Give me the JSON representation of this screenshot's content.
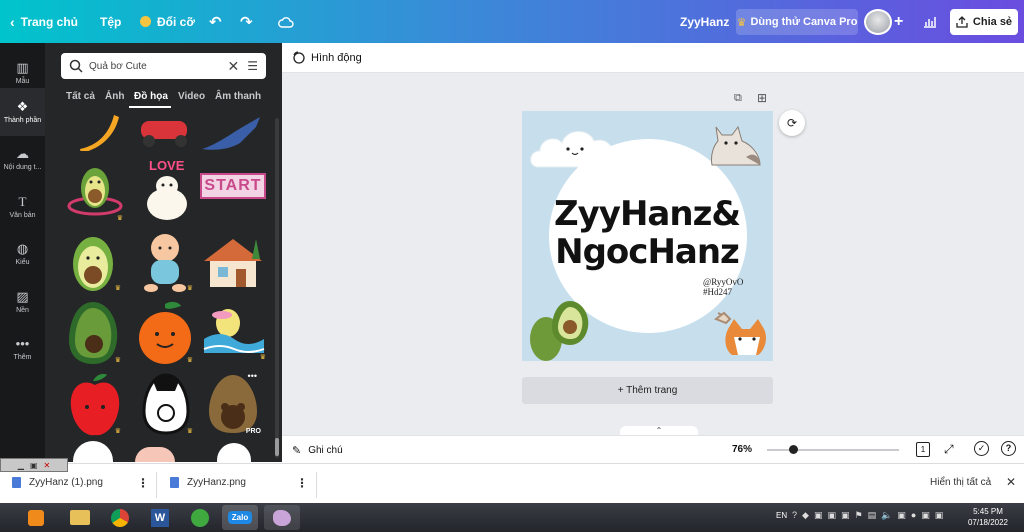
{
  "topbar": {
    "home_label": "Trang chủ",
    "file_label": "Tệp",
    "resize_label": "Đổi cỡ",
    "user_name": "ZyyHanz",
    "pro_label": "Dùng thử Canva Pro",
    "share_label": "Chia sẻ"
  },
  "rail": {
    "items": [
      {
        "label": "Mẫu",
        "icon": "template-icon"
      },
      {
        "label": "Thành phần",
        "icon": "elements-icon"
      },
      {
        "label": "Nội dung t...",
        "icon": "upload-icon"
      },
      {
        "label": "Văn bản",
        "icon": "text-icon"
      },
      {
        "label": "Kiểu",
        "icon": "style-icon"
      },
      {
        "label": "Nền",
        "icon": "background-icon"
      },
      {
        "label": "Thêm",
        "icon": "more-icon"
      }
    ]
  },
  "panel": {
    "search_value": "Quả bơ Cute",
    "tabs": [
      "Tất cả",
      "Ảnh",
      "Đồ họa",
      "Video",
      "Âm thanh"
    ],
    "active_tab": "Đồ họa",
    "love_text": "LOVE",
    "start_text": "START",
    "pro_badge": "PRO"
  },
  "subbar": {
    "animation_label": "Hình động"
  },
  "design": {
    "title_line1": "ZyyHanz&",
    "title_line2": "NgocHanz",
    "handle": "@RyyOvO",
    "tag": "#Hd247",
    "bg_color": "#c7dfed"
  },
  "add_page_label": "+ Thêm trang",
  "footer": {
    "notes_label": "Ghi chú",
    "zoom": "76%",
    "zoom_fraction": 0.2,
    "page_count": "1"
  },
  "downloads": {
    "items": [
      "ZyyHanz (1).png",
      "ZyyHanz.png"
    ],
    "show_all": "Hiển thị tất cả"
  },
  "taskbar": {
    "lang": "EN",
    "time": "5:45 PM",
    "date": "07/18/2022",
    "zalo_label": "Zalo"
  }
}
